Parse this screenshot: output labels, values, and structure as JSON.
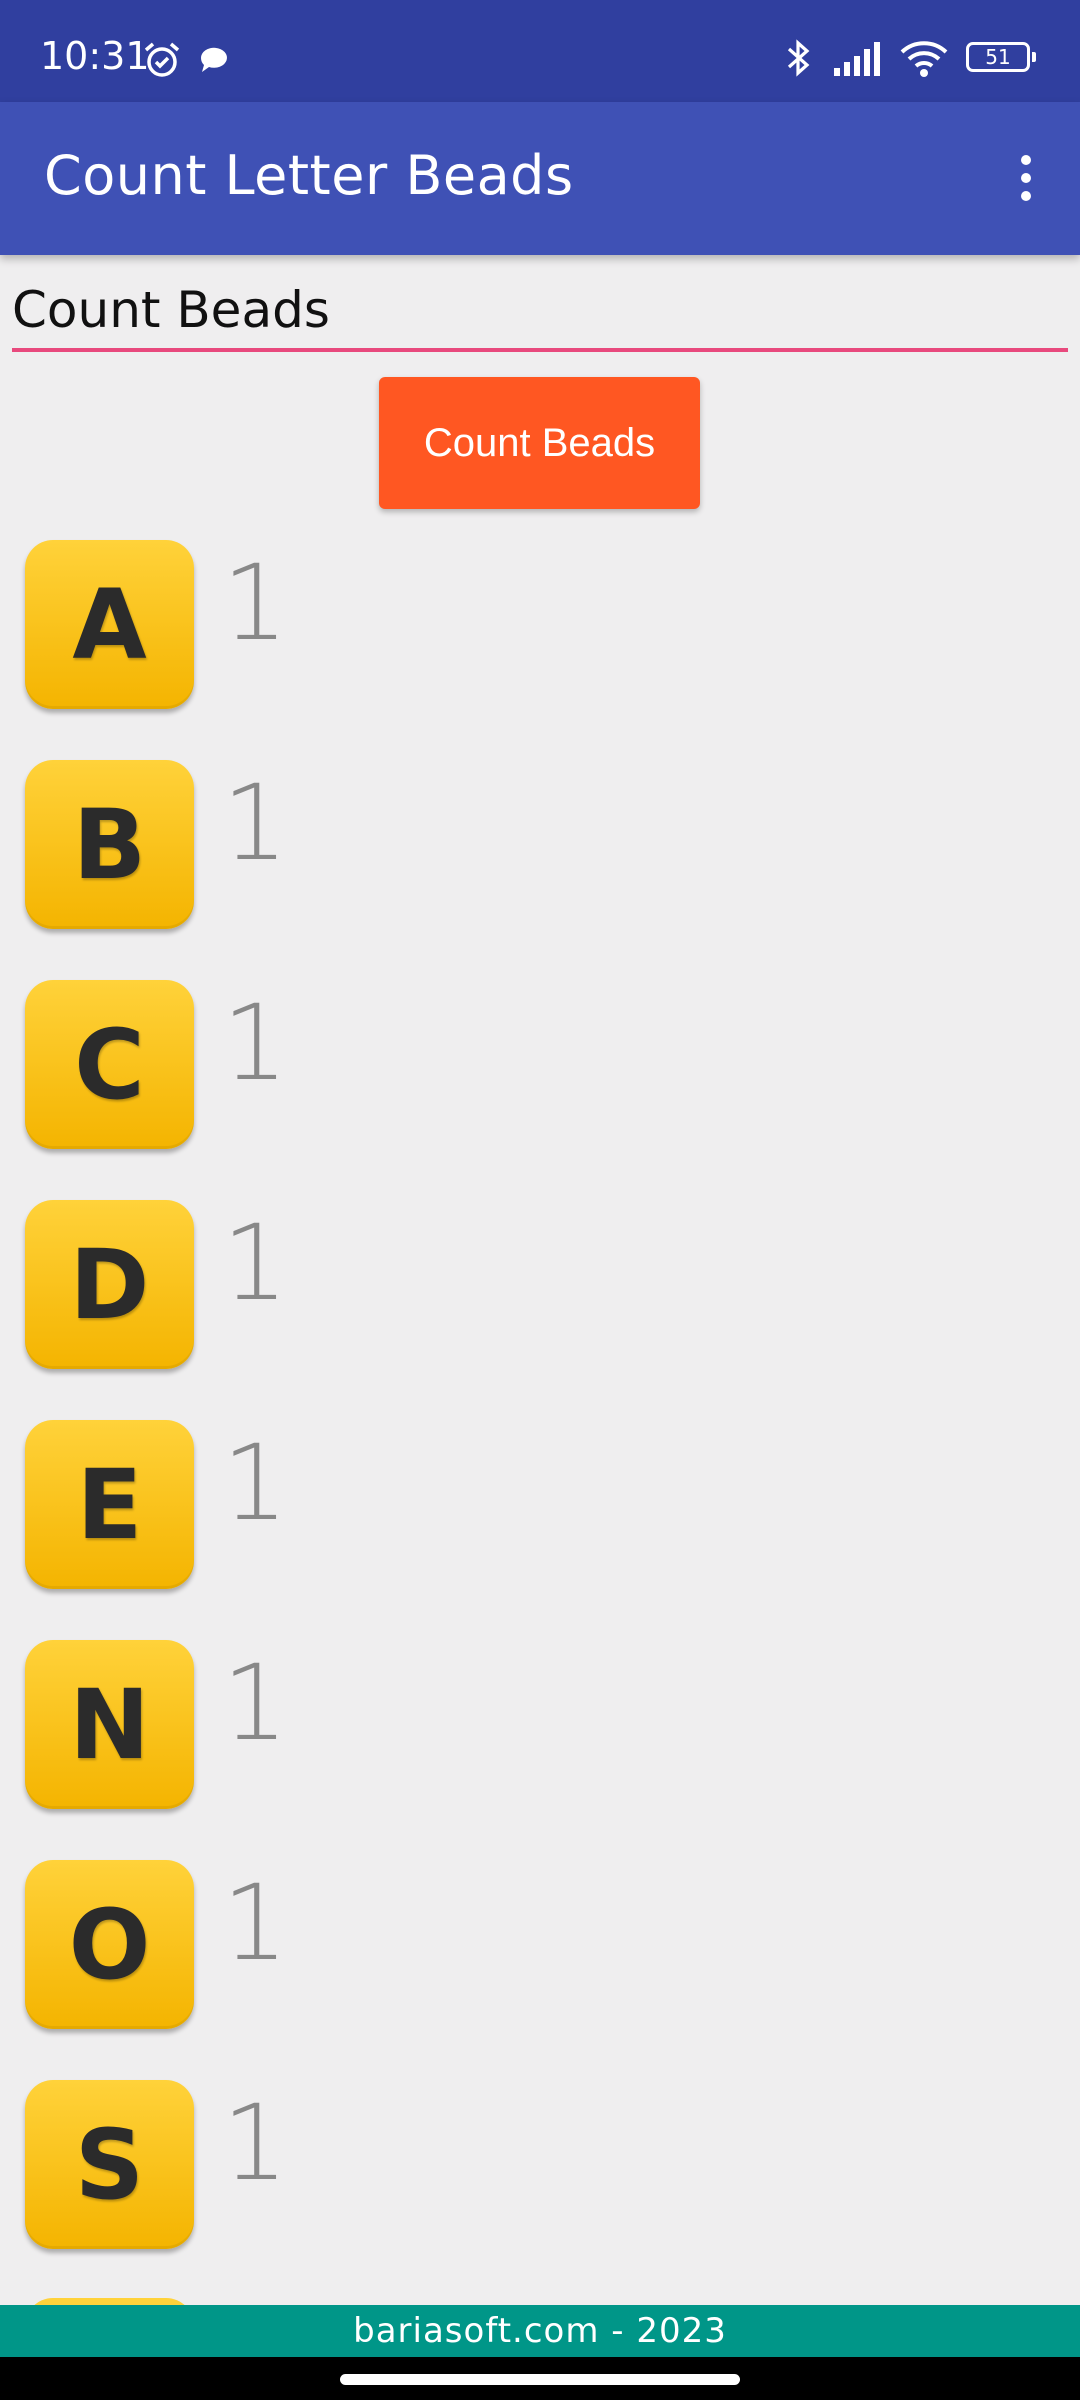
{
  "status_bar": {
    "time": "10:31",
    "battery": "51",
    "left_icons": [
      "alarm-icon",
      "chat-icon"
    ],
    "right_icons": [
      "bluetooth-icon",
      "signal-icon",
      "wifi-icon",
      "battery-icon"
    ]
  },
  "app_bar": {
    "title": "Count Letter Beads",
    "menu_icon": "overflow-menu-icon"
  },
  "search": {
    "value": "Count Beads"
  },
  "count_button": {
    "label": "Count Beads",
    "color": "#ff5722"
  },
  "beads": [
    {
      "letter": "A",
      "count": "1"
    },
    {
      "letter": "B",
      "count": "1"
    },
    {
      "letter": "C",
      "count": "1"
    },
    {
      "letter": "D",
      "count": "1"
    },
    {
      "letter": "E",
      "count": "1"
    },
    {
      "letter": "N",
      "count": "1"
    },
    {
      "letter": "O",
      "count": "1"
    },
    {
      "letter": "S",
      "count": "1"
    }
  ],
  "footer": {
    "text": "bariasoft.com - 2023"
  },
  "colors": {
    "status_bar": "#303f9f",
    "app_bar": "#3f51b5",
    "accent": "#e8497d",
    "bead": "#ffc107",
    "footer": "#009688"
  }
}
